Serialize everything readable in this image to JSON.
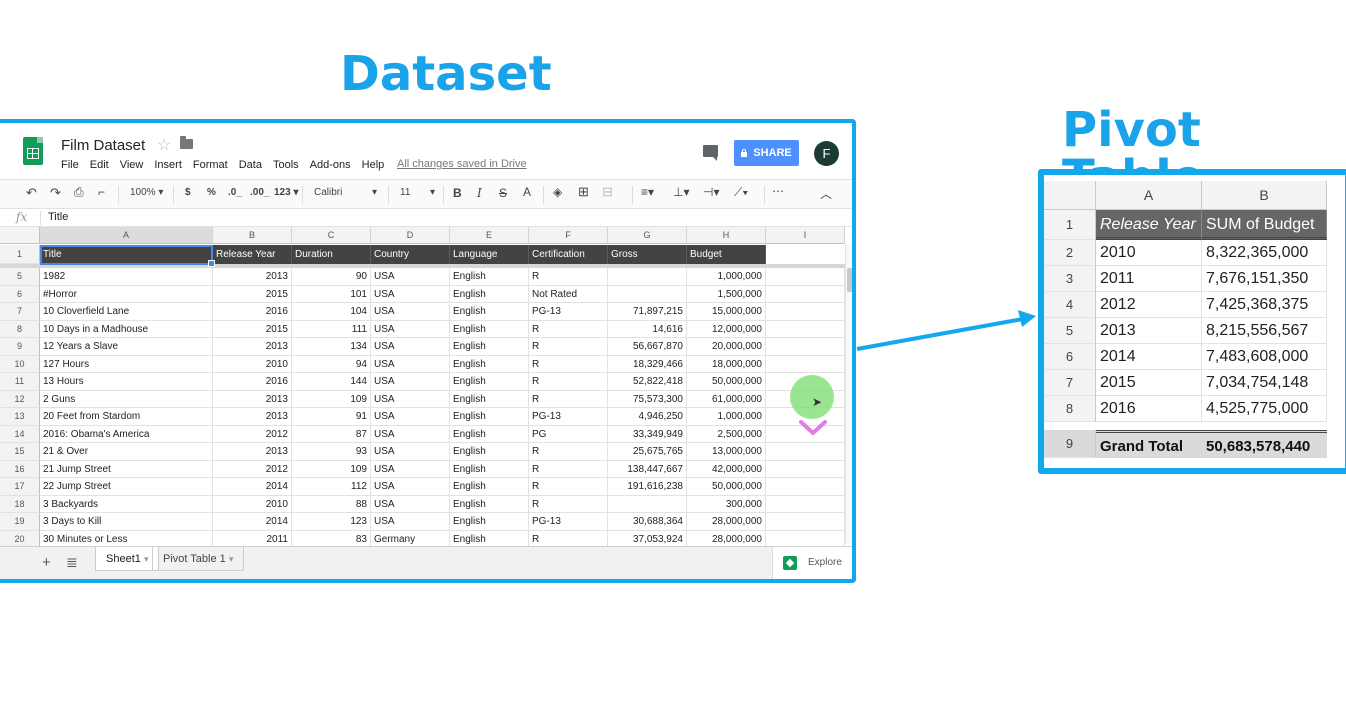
{
  "headings": {
    "dataset": "Dataset",
    "pivot": "Pivot Table"
  },
  "app": {
    "doc_title": "Film Dataset",
    "menus": [
      "File",
      "Edit",
      "View",
      "Insert",
      "Format",
      "Data",
      "Tools",
      "Add-ons",
      "Help"
    ],
    "save_status": "All changes saved in Drive",
    "share_label": "SHARE",
    "avatar_letter": "F"
  },
  "toolbar": {
    "zoom": "100%",
    "currency": "$",
    "percent": "%",
    "dec_less": ".0_",
    "dec_more": ".00_",
    "more_formats": "123",
    "font": "Calibri",
    "font_size": "11"
  },
  "formula_bar": {
    "fx": "fx",
    "value": "Title"
  },
  "sheet": {
    "columns": [
      "A",
      "B",
      "C",
      "D",
      "E",
      "F",
      "G",
      "H",
      "I"
    ],
    "header_row_number": "1",
    "headers": [
      "Title",
      "Release Year",
      "Duration",
      "Country",
      "Language",
      "Certification",
      "Gross",
      "Budget"
    ],
    "rows": [
      {
        "n": "5",
        "v": [
          "1982",
          "2013",
          "90",
          "USA",
          "English",
          "R",
          "",
          "1,000,000"
        ]
      },
      {
        "n": "6",
        "v": [
          "#Horror",
          "2015",
          "101",
          "USA",
          "English",
          "Not Rated",
          "",
          "1,500,000"
        ]
      },
      {
        "n": "7",
        "v": [
          "10 Cloverfield Lane",
          "2016",
          "104",
          "USA",
          "English",
          "PG-13",
          "71,897,215",
          "15,000,000"
        ]
      },
      {
        "n": "8",
        "v": [
          "10 Days in a Madhouse",
          "2015",
          "111",
          "USA",
          "English",
          "R",
          "14,616",
          "12,000,000"
        ]
      },
      {
        "n": "9",
        "v": [
          "12 Years a Slave",
          "2013",
          "134",
          "USA",
          "English",
          "R",
          "56,667,870",
          "20,000,000"
        ]
      },
      {
        "n": "10",
        "v": [
          "127 Hours",
          "2010",
          "94",
          "USA",
          "English",
          "R",
          "18,329,466",
          "18,000,000"
        ]
      },
      {
        "n": "11",
        "v": [
          "13 Hours",
          "2016",
          "144",
          "USA",
          "English",
          "R",
          "52,822,418",
          "50,000,000"
        ]
      },
      {
        "n": "12",
        "v": [
          "2 Guns",
          "2013",
          "109",
          "USA",
          "English",
          "R",
          "75,573,300",
          "61,000,000"
        ]
      },
      {
        "n": "13",
        "v": [
          "20 Feet from Stardom",
          "2013",
          "91",
          "USA",
          "English",
          "PG-13",
          "4,946,250",
          "1,000,000"
        ]
      },
      {
        "n": "14",
        "v": [
          "2016: Obama's America",
          "2012",
          "87",
          "USA",
          "English",
          "PG",
          "33,349,949",
          "2,500,000"
        ]
      },
      {
        "n": "15",
        "v": [
          "21 & Over",
          "2013",
          "93",
          "USA",
          "English",
          "R",
          "25,675,765",
          "13,000,000"
        ]
      },
      {
        "n": "16",
        "v": [
          "21 Jump Street",
          "2012",
          "109",
          "USA",
          "English",
          "R",
          "138,447,667",
          "42,000,000"
        ]
      },
      {
        "n": "17",
        "v": [
          "22 Jump Street",
          "2014",
          "112",
          "USA",
          "English",
          "R",
          "191,616,238",
          "50,000,000"
        ]
      },
      {
        "n": "18",
        "v": [
          "3 Backyards",
          "2010",
          "88",
          "USA",
          "English",
          "R",
          "",
          "300,000"
        ]
      },
      {
        "n": "19",
        "v": [
          "3 Days to Kill",
          "2014",
          "123",
          "USA",
          "English",
          "PG-13",
          "30,688,364",
          "28,000,000"
        ]
      },
      {
        "n": "20",
        "v": [
          "30 Minutes or Less",
          "2011",
          "83",
          "Germany",
          "English",
          "R",
          "37,053,924",
          "28,000,000"
        ]
      }
    ],
    "tabs": [
      "Sheet1",
      "Pivot Table 1"
    ],
    "explore_label": "Explore"
  },
  "pivot": {
    "columns": [
      "A",
      "B"
    ],
    "header_row_number": "1",
    "headers": [
      "Release Year",
      "SUM of Budget"
    ],
    "rows": [
      {
        "n": "2",
        "year": "2010",
        "sum": "8,322,365,000"
      },
      {
        "n": "3",
        "year": "2011",
        "sum": "7,676,151,350"
      },
      {
        "n": "4",
        "year": "2012",
        "sum": "7,425,368,375"
      },
      {
        "n": "5",
        "year": "2013",
        "sum": "8,215,556,567"
      },
      {
        "n": "6",
        "year": "2014",
        "sum": "7,483,608,000"
      },
      {
        "n": "7",
        "year": "2015",
        "sum": "7,034,754,148"
      },
      {
        "n": "8",
        "year": "2016",
        "sum": "4,525,775,000"
      }
    ],
    "total_row_number": "9",
    "total_label": "Grand Total",
    "total_value": "50,683,578,440"
  },
  "colors": {
    "accent": "#12a8ee",
    "header_fill": "#434343",
    "pivot_header_fill": "#666666",
    "share": "#4d90fe",
    "sheets_green": "#0f9d58"
  }
}
